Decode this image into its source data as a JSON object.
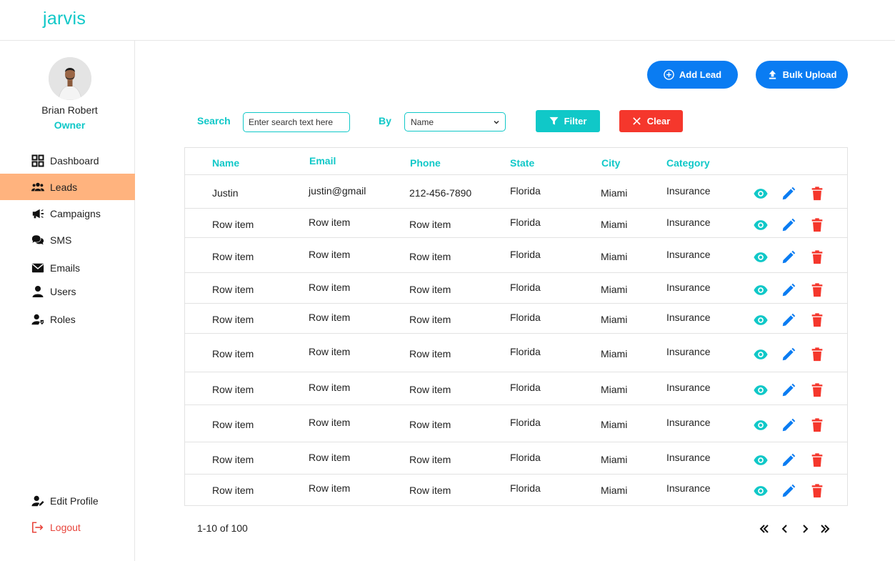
{
  "app": {
    "title": "jarvis"
  },
  "profile": {
    "name": "Brian Robert",
    "role": "Owner"
  },
  "nav": [
    {
      "label": "Dashboard",
      "icon": "dashboard-icon"
    },
    {
      "label": "Leads",
      "icon": "users-group-icon",
      "active": true
    },
    {
      "label": "Campaigns",
      "icon": "megaphone-icon"
    },
    {
      "label": "SMS",
      "icon": "chat-bubbles-icon"
    },
    {
      "label": "Emails",
      "icon": "envelope-icon"
    },
    {
      "label": "Users",
      "icon": "user-icon"
    },
    {
      "label": "Roles",
      "icon": "user-role-icon"
    }
  ],
  "nav_bottom": {
    "edit_profile": "Edit Profile",
    "logout": "Logout"
  },
  "actions": {
    "add_lead": "Add Lead",
    "bulk_upload": "Bulk Upload"
  },
  "search": {
    "label": "Search",
    "placeholder": "Enter search text here",
    "by_label": "By",
    "by_value": "Name",
    "filter": "Filter",
    "clear": "Clear"
  },
  "table": {
    "columns": [
      "Name",
      "Email",
      "Phone",
      "State",
      "City",
      "Category"
    ],
    "rows": [
      [
        "Justin",
        "justin@gmail",
        "212-456-7890",
        "Florida",
        "Miami",
        "Insurance"
      ],
      [
        "Row item",
        "Row item",
        "Row item",
        "Florida",
        "Miami",
        "Insurance"
      ],
      [
        "Row item",
        "Row item",
        "Row item",
        "Florida",
        "Miami",
        "Insurance"
      ],
      [
        "Row item",
        "Row item",
        "Row item",
        "Florida",
        "Miami",
        "Insurance"
      ],
      [
        "Row item",
        "Row item",
        "Row item",
        "Florida",
        "Miami",
        "Insurance"
      ],
      [
        "Row item",
        "Row item",
        "Row item",
        "Florida",
        "Miami",
        "Insurance"
      ],
      [
        "Row item",
        "Row item",
        "Row item",
        "Florida",
        "Miami",
        "Insurance"
      ],
      [
        "Row item",
        "Row item",
        "Row item",
        "Florida",
        "Miami",
        "Insurance"
      ],
      [
        "Row item",
        "Row item",
        "Row item",
        "Florida",
        "Miami",
        "Insurance"
      ],
      [
        "Row item",
        "Row item",
        "Row item",
        "Florida",
        "Miami",
        "Insurance"
      ]
    ]
  },
  "pagination": {
    "summary": "1-10 of 100"
  },
  "colors": {
    "accent": "#10c8c8",
    "primary": "#0a7cf2",
    "danger": "#f5372c",
    "active_nav": "#ffb37e"
  }
}
